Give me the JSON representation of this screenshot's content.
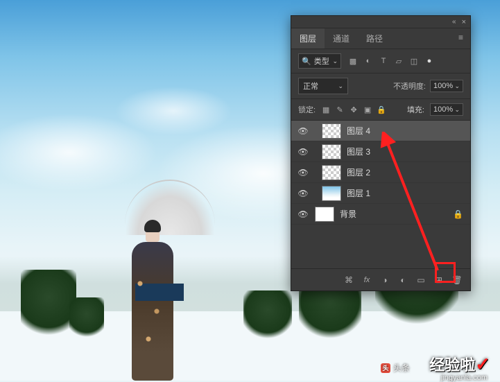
{
  "panel": {
    "tabs": {
      "layers": "图层",
      "channels": "通道",
      "paths": "路径"
    },
    "filter": {
      "search_label": "类型"
    },
    "blend": {
      "mode": "正常",
      "opacity_label": "不透明度:",
      "opacity_value": "100%"
    },
    "lock": {
      "label": "锁定:",
      "fill_label": "填充:",
      "fill_value": "100%"
    },
    "layers": [
      {
        "name": "图层 4",
        "thumb": "checker",
        "selected": true,
        "indented": true
      },
      {
        "name": "图层 3",
        "thumb": "checker",
        "selected": false,
        "indented": true
      },
      {
        "name": "图层 2",
        "thumb": "checker",
        "selected": false,
        "indented": true
      },
      {
        "name": "图层 1",
        "thumb": "sky",
        "selected": false,
        "indented": true
      },
      {
        "name": "背景",
        "thumb": "white",
        "selected": false,
        "indented": false,
        "locked": true
      }
    ]
  },
  "watermark": {
    "main": "经验啦",
    "url": "jingyanla.com",
    "source_label": "头条"
  }
}
